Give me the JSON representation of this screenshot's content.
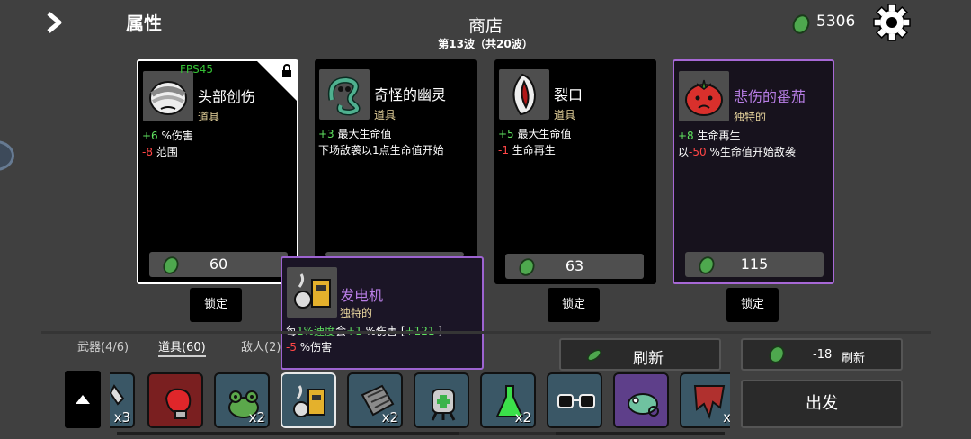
{
  "header": {
    "attributes_label": "属性",
    "shop_title": "商店",
    "wave_text": "第13波（共20波）",
    "materials": "5306",
    "fps": "FPS45"
  },
  "cards": [
    {
      "name": "头部创伤",
      "type": "道具",
      "stats": [
        {
          "value": "+6",
          "text": " %伤害"
        },
        {
          "value": "-8",
          "text": " 范围"
        }
      ],
      "price": "60",
      "lock": "锁定"
    },
    {
      "name": "奇怪的幽灵",
      "type": "道具",
      "stats": [
        {
          "value": "+3",
          "text": " 最大生命值"
        },
        {
          "value": "",
          "text": "下场敌袭以1点生命值开始"
        }
      ],
      "price": "",
      "lock": ""
    },
    {
      "name": "裂口",
      "type": "道具",
      "stats": [
        {
          "value": "+5",
          "text": " 最大生命值"
        },
        {
          "value": "-1",
          "text": " 生命再生"
        }
      ],
      "price": "63",
      "lock": "锁定"
    },
    {
      "name": "悲伤的番茄",
      "type": "独特的",
      "stats": [
        {
          "value": "+8",
          "text": " 生命再生"
        },
        {
          "prefix": "以",
          "value": "-50",
          "text": " %生命值开始敌袭"
        }
      ],
      "price": "115",
      "lock": "锁定"
    }
  ],
  "tooltip": {
    "name": "发电机",
    "type": "独特的",
    "line1_a": "每",
    "line1_b": "1%速度",
    "line1_c": "会",
    "line1_d": "+1",
    "line1_e": " %伤害 [",
    "line1_f": "+121",
    "line1_g": " ]",
    "line2_value": "-5",
    "line2_text": " %伤害"
  },
  "tabs": [
    "武器(4/6)",
    "道具(60)",
    "敌人(2)"
  ],
  "buttons": {
    "refresh": "刷新",
    "refresh_cost": "-18",
    "refresh2": "刷新",
    "go": "出发"
  },
  "inventory": [
    {
      "name": "cut-off-item",
      "qty": "x3"
    },
    {
      "name": "boxing-glove",
      "qty": ""
    },
    {
      "name": "frog",
      "qty": "x2"
    },
    {
      "name": "generator",
      "qty": ""
    },
    {
      "name": "gauntlet",
      "qty": "x2"
    },
    {
      "name": "robot-head",
      "qty": ""
    },
    {
      "name": "flask",
      "qty": "x2"
    },
    {
      "name": "glasses",
      "qty": ""
    },
    {
      "name": "chameleon",
      "qty": ""
    },
    {
      "name": "banner",
      "qty": "x"
    }
  ],
  "colors": {
    "positive": "#5fe25f",
    "negative": "#ff4646",
    "unique": "#b77de4",
    "type_text": "#e9d69e",
    "coin": "#4ea84e"
  }
}
